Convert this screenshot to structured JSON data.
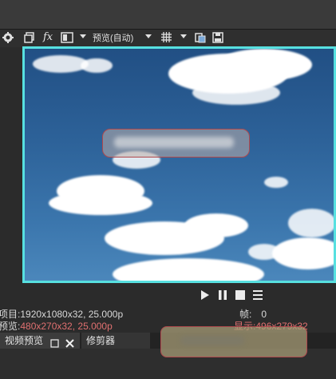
{
  "toolbar": {
    "icons": [
      "gear-icon",
      "copy-icon",
      "fx-icon",
      "split-view-icon",
      "grid-icon",
      "paste-icon",
      "save-icon"
    ],
    "fx_label": "fx",
    "preview_mode_label": "预览(自动)"
  },
  "preview": {
    "border_color": "#57e0e0",
    "redaction_color": "#b0494d"
  },
  "transport": {
    "icons": [
      "play-icon",
      "pause-icon",
      "stop-icon",
      "menu-icon"
    ]
  },
  "info": {
    "project_label": "项目:",
    "project_value": "1920x1080x32, 25.000p",
    "preview_label": "预览:",
    "preview_value": "480x270x32, 25.000p",
    "frame_label": "帧:",
    "frame_value": "0",
    "display_label": "显示:",
    "display_value": "496x279x32",
    "highlight_color": "#e07070"
  },
  "tabs": {
    "video_preview": "视频预览",
    "clipper": "修剪器"
  }
}
